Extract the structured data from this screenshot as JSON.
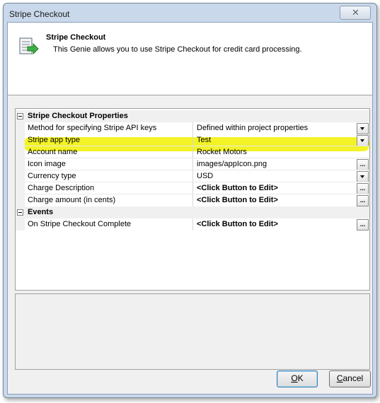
{
  "window": {
    "title": "Stripe Checkout",
    "close_glyph": "✕"
  },
  "header": {
    "title": "Stripe Checkout",
    "description": "This Genie allows you to use Stripe Checkout for credit card processing.",
    "icon": "wizard-document-icon"
  },
  "grid": {
    "categories": [
      {
        "label": "Stripe Checkout Properties"
      },
      {
        "label": "Events"
      }
    ],
    "properties": [
      {
        "name": "Method for specifying Stripe API keys",
        "value": "Defined within project properties",
        "editor": "dropdown"
      },
      {
        "name": "Stripe app type",
        "value": "Test",
        "editor": "dropdown"
      },
      {
        "name": "Account name",
        "value": "Rocket Motors",
        "editor": "none"
      },
      {
        "name": "Icon image",
        "value": "images/appIcon.png",
        "editor": "ellipsis"
      },
      {
        "name": "Currency type",
        "value": "USD",
        "editor": "dropdown"
      },
      {
        "name": "Charge Description",
        "value": "<Click Button to Edit>",
        "editor": "ellipsis"
      },
      {
        "name": "Charge amount (in cents)",
        "value": "<Click Button to Edit>",
        "editor": "ellipsis"
      }
    ],
    "events": [
      {
        "name": "On Stripe Checkout Complete",
        "value": "<Click Button to Edit>",
        "editor": "ellipsis"
      }
    ],
    "ellipsis_label": "...",
    "highlight_color": "#f2f21a"
  },
  "buttons": {
    "ok_prefix": "",
    "ok_mnemonic": "O",
    "ok_rest": "K",
    "cancel_prefix": "",
    "cancel_mnemonic": "C",
    "cancel_rest": "ancel"
  }
}
